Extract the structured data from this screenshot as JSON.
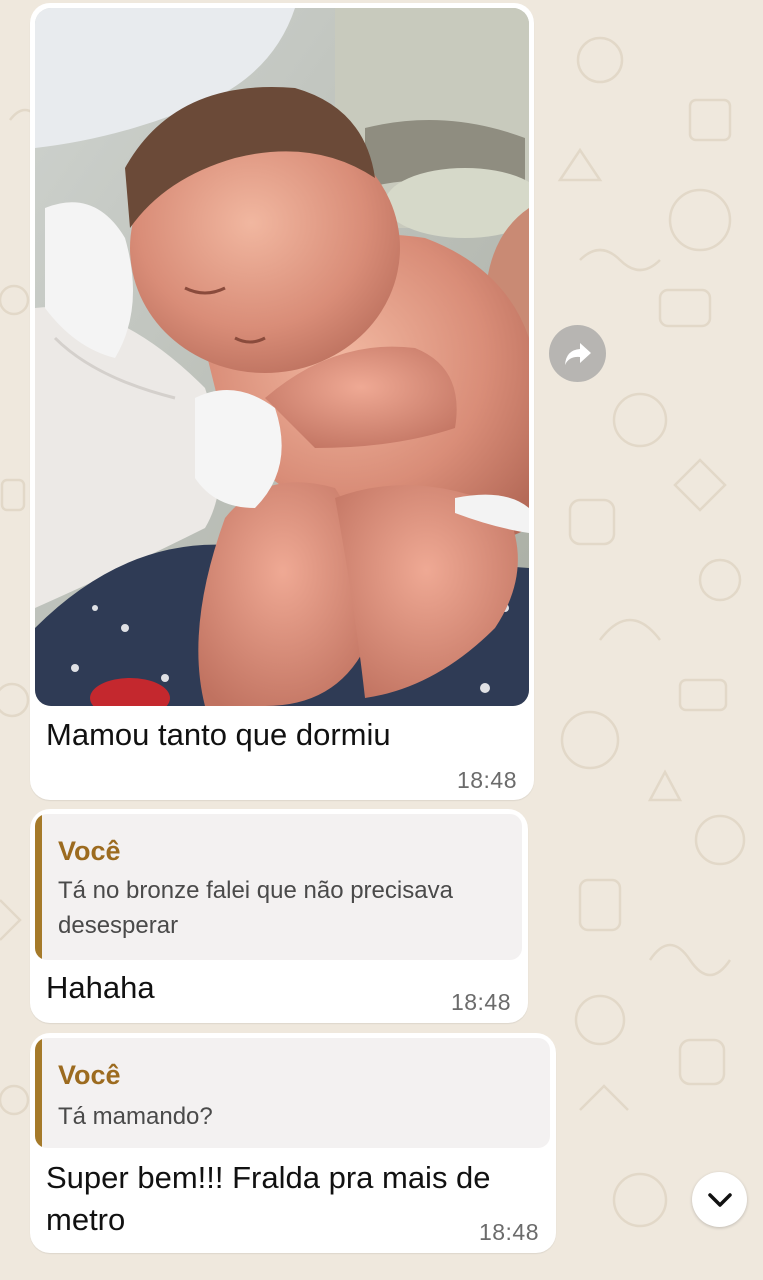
{
  "messages": [
    {
      "type": "image",
      "caption": "Mamou tanto que dormiu",
      "time": "18:48"
    },
    {
      "type": "reply",
      "quote_author": "Você",
      "quote_text": "Tá no bronze falei que não precisava desesperar",
      "text": "Hahaha",
      "time": "18:48"
    },
    {
      "type": "reply",
      "quote_author": "Você",
      "quote_text": "Tá mamando?",
      "text": "Super bem!!! Fralda pra mais de metro",
      "time": "18:48"
    }
  ],
  "icons": {
    "forward": "forward-arrow-icon",
    "scroll_down": "chevron-down-icon"
  },
  "colors": {
    "wallpaper": "#efe8dd",
    "bubble": "#ffffff",
    "quote_accent": "#a57a2a",
    "quote_author": "#9c6b1f"
  }
}
